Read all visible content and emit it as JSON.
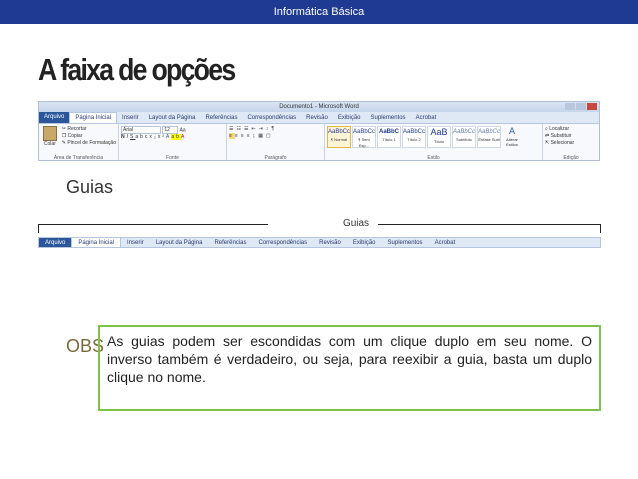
{
  "header": {
    "title": "Informática Básica"
  },
  "slide": {
    "title": "A faixa de opções",
    "subheading": "Guias",
    "bracket_label": "Guias"
  },
  "ribbon": {
    "window_title": "Documento1 - Microsoft Word",
    "tabs": [
      "Arquivo",
      "Página Inicial",
      "Inserir",
      "Layout da Página",
      "Referências",
      "Correspondências",
      "Revisão",
      "Exibição",
      "Suplementos",
      "Acrobat"
    ],
    "active_tab": "Página Inicial",
    "clipboard": {
      "paste": "Colar",
      "cut": "Recortar",
      "copy": "Copiar",
      "format_painter": "Pincel de Formatação",
      "label": "Área de Transferência"
    },
    "font": {
      "name": "Arial",
      "size": "12",
      "label": "Fonte"
    },
    "paragraph": {
      "label": "Parágrafo"
    },
    "styles": {
      "items": [
        {
          "preview": "AaBbCc",
          "name": "¶ Normal"
        },
        {
          "preview": "AaBbCc",
          "name": "¶ Sem Esp..."
        },
        {
          "preview": "AaBbC",
          "name": "Título 1"
        },
        {
          "preview": "AaBbCc",
          "name": "Título 2"
        },
        {
          "preview": "AaB",
          "name": "Título"
        },
        {
          "preview": "AaBbCc",
          "name": "Subtítulo"
        },
        {
          "preview": "AaBbCc",
          "name": "Ênfase Sutil"
        }
      ],
      "change": "Alterar Estilos",
      "label": "Estilo"
    },
    "editing": {
      "find": "Localizar",
      "replace": "Substituir",
      "select": "Selecionar",
      "label": "Edição"
    }
  },
  "obs": {
    "label": "OBS",
    "text": "As guias podem ser escondidas com um clique duplo em seu nome. O inverso também é verdadeiro, ou seja, para reexibir a guia, basta um duplo clique no nome."
  },
  "colors": {
    "topbar": "#1f3a93",
    "obs_border": "#7fc24a",
    "obs_label": "#7a6a3a",
    "file_tab": "#2b579a"
  }
}
